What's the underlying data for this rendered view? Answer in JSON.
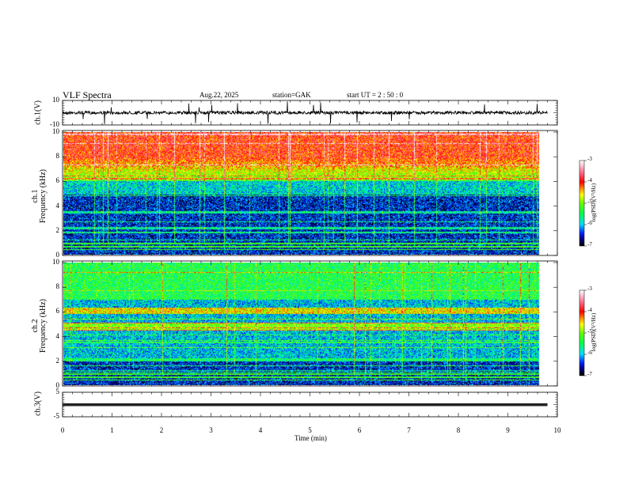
{
  "header": {
    "title": "VLF  Spectra",
    "date": "Aug.22, 2025",
    "station": "station=GAK",
    "start_ut": "start  UT  =   2  : 50 : 0"
  },
  "chart_data": [
    {
      "type": "line",
      "name": "ch1-waveform",
      "ylabel": "ch.1(V)",
      "ylim": [
        -10,
        10
      ],
      "yticks": [
        "10",
        "-10"
      ],
      "xlim": [
        0,
        10
      ]
    },
    {
      "type": "heatmap",
      "name": "ch1-spectrogram",
      "ylabel": "ch.1\nFrequency  (kHz)",
      "ylabel_lines": [
        "ch.1",
        "Frequency  (kHz)"
      ],
      "ylim": [
        0,
        10
      ],
      "yticks": [
        "0",
        "2",
        "4",
        "6",
        "8",
        "10"
      ],
      "xlim": [
        0,
        10
      ],
      "data_end_min": 9.8,
      "colorbar": {
        "label": "log(PSD)(V²/Hz)",
        "range": [
          -7,
          -3
        ],
        "ticks": [
          "-3",
          "-4",
          "-5",
          "-6",
          "-7"
        ]
      }
    },
    {
      "type": "heatmap",
      "name": "ch2-spectrogram",
      "ylabel_lines": [
        "ch.2",
        "Frequency  (kHz)"
      ],
      "ylim": [
        0,
        10
      ],
      "yticks": [
        "0",
        "2",
        "4",
        "6",
        "8",
        "10"
      ],
      "xlim": [
        0,
        10
      ],
      "data_end_min": 9.8,
      "colorbar": {
        "label": "log(PSD)(V²/Hz)",
        "range": [
          -7,
          -3
        ],
        "ticks": [
          "-3",
          "-4",
          "-5",
          "-6",
          "-7"
        ]
      }
    },
    {
      "type": "line",
      "name": "ch3-waveform",
      "ylabel": "ch.3(V)",
      "ylim": [
        -5,
        5
      ],
      "yticks": [
        "5",
        "-5"
      ],
      "xlim": [
        0,
        10
      ]
    }
  ],
  "xaxis": {
    "label": "Time  (min)",
    "ticks": [
      "0",
      "1",
      "2",
      "3",
      "4",
      "5",
      "6",
      "7",
      "8",
      "9",
      "10"
    ]
  },
  "colormap": [
    "#000000",
    "#0000a0",
    "#0040ff",
    "#00e0ff",
    "#00ff40",
    "#c0ff00",
    "#ffff00",
    "#ff8000",
    "#ff0000",
    "#ff80a0",
    "#ffffff"
  ]
}
